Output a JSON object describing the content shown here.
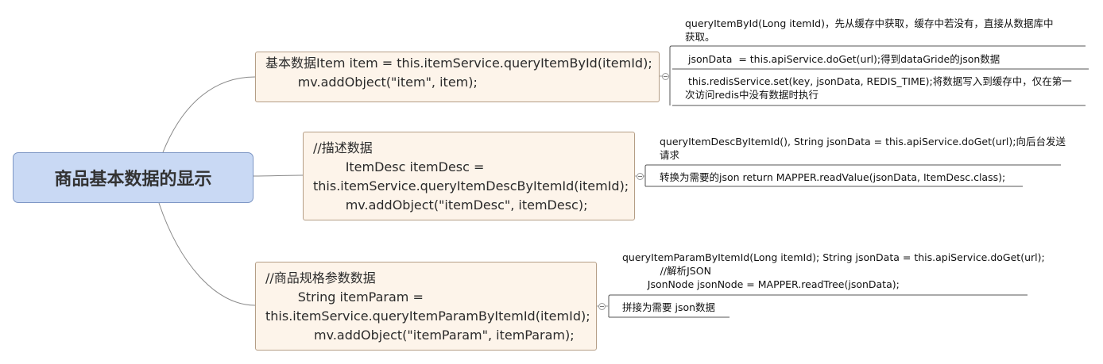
{
  "root": {
    "label": "商品基本数据的显示"
  },
  "branches": [
    {
      "lines": [
        "基本数据Item item = this.itemService.queryItemById(itemId);",
        "        mv.addObject(\"item\", item);"
      ],
      "notes": [
        "queryItemById(Long itemId)，先从缓存中获取，缓存中若没有，直接从数据库中\n获取。",
        " jsonData  = this.apiService.doGet(url);得到dataGride的json数据",
        " this.redisService.set(key, jsonData, REDIS_TIME);将数据写入到缓存中，仅在第一\n次访问redis中没有数据时执行"
      ]
    },
    {
      "lines": [
        "//描述数据",
        "        ItemDesc itemDesc =",
        "this.itemService.queryItemDescByItemId(itemId);",
        "        mv.addObject(\"itemDesc\", itemDesc);"
      ],
      "notes": [
        "queryItemDescByItemId(), String jsonData = this.apiService.doGet(url);向后台发送\n请求",
        "转换为需要的json return MAPPER.readValue(jsonData, ItemDesc.class);"
      ]
    },
    {
      "lines": [
        "//商品规格参数数据",
        "        String itemParam =",
        "this.itemService.queryItemParamByItemId(itemId);",
        "            mv.addObject(\"itemParam\", itemParam);"
      ],
      "notes": [
        "queryItemParamByItemId(Long itemId); String jsonData = this.apiService.doGet(url);\n            //解析JSON\n        JsonNode jsonNode = MAPPER.readTree(jsonData);",
        "拼接为需要 json数据"
      ]
    }
  ]
}
